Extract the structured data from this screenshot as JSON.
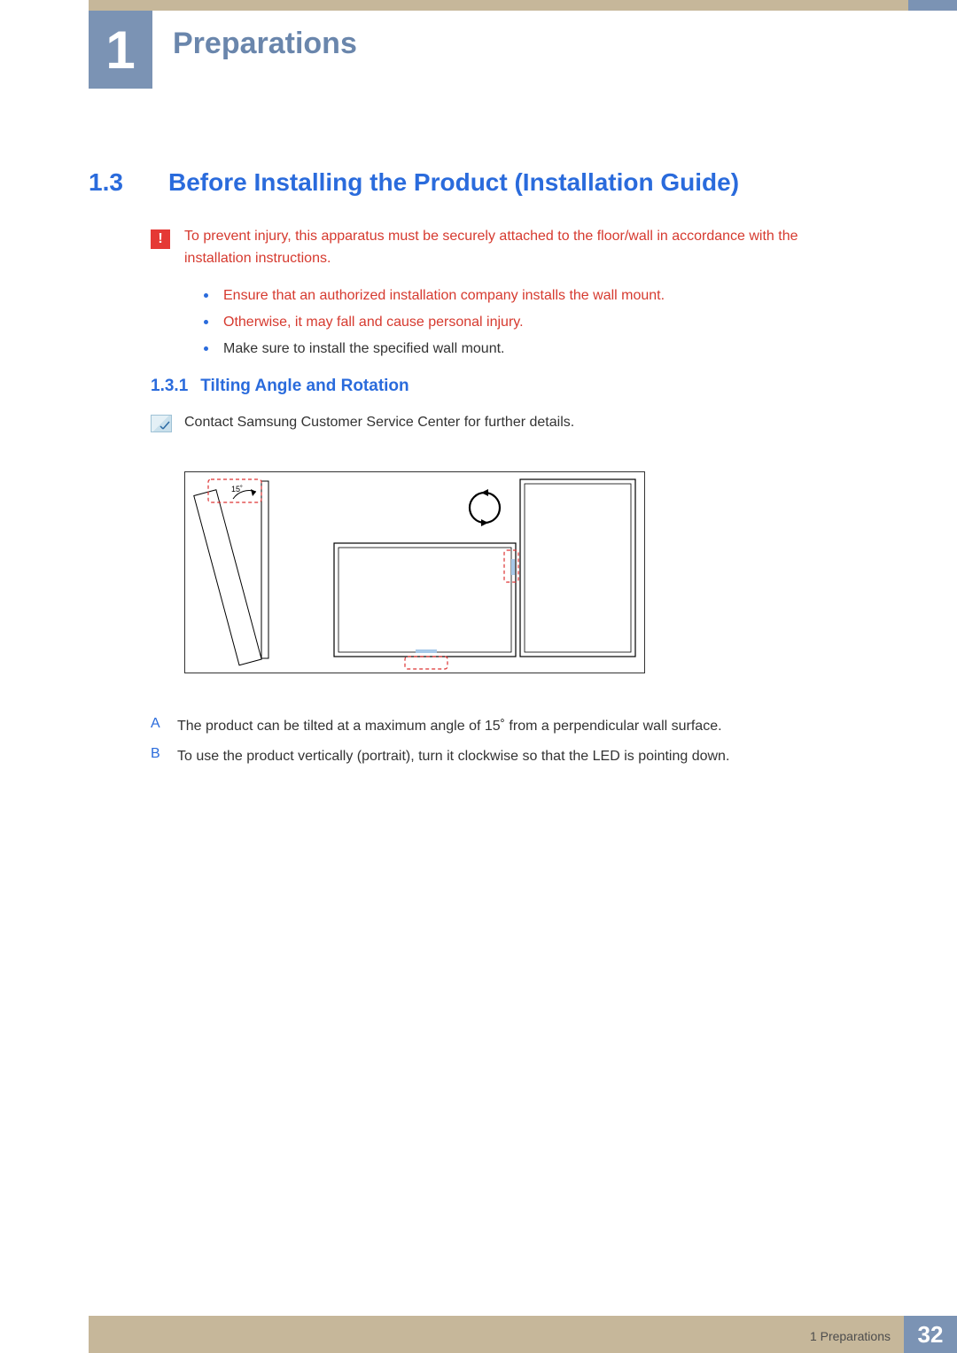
{
  "chapter": {
    "number": "1",
    "title": "Preparations"
  },
  "section": {
    "number": "1.3",
    "title": "Before Installing the Product (Installation Guide)"
  },
  "warning": {
    "intro": "To prevent injury, this apparatus must be securely attached to the floor/wall in accordance with the installation instructions.",
    "bullets": [
      {
        "text": "Ensure that an authorized installation company installs the wall mount.",
        "red": true
      },
      {
        "text": "Otherwise, it may fall and cause personal injury.",
        "red": true
      },
      {
        "text": "Make sure to install the specified wall mount.",
        "red": false
      }
    ]
  },
  "subsection": {
    "number": "1.3.1",
    "title": "Tilting Angle and Rotation"
  },
  "note": {
    "text": "Contact Samsung Customer Service Center for further details."
  },
  "diagram": {
    "tilt_label": "15˚"
  },
  "letters": {
    "A": "The product can be tilted at a maximum angle of 15˚ from a perpendicular wall surface.",
    "B": "To use the product vertically (portrait), turn it clockwise so that the LED is pointing down."
  },
  "footer": {
    "caption": "1 Preparations",
    "page": "32"
  }
}
